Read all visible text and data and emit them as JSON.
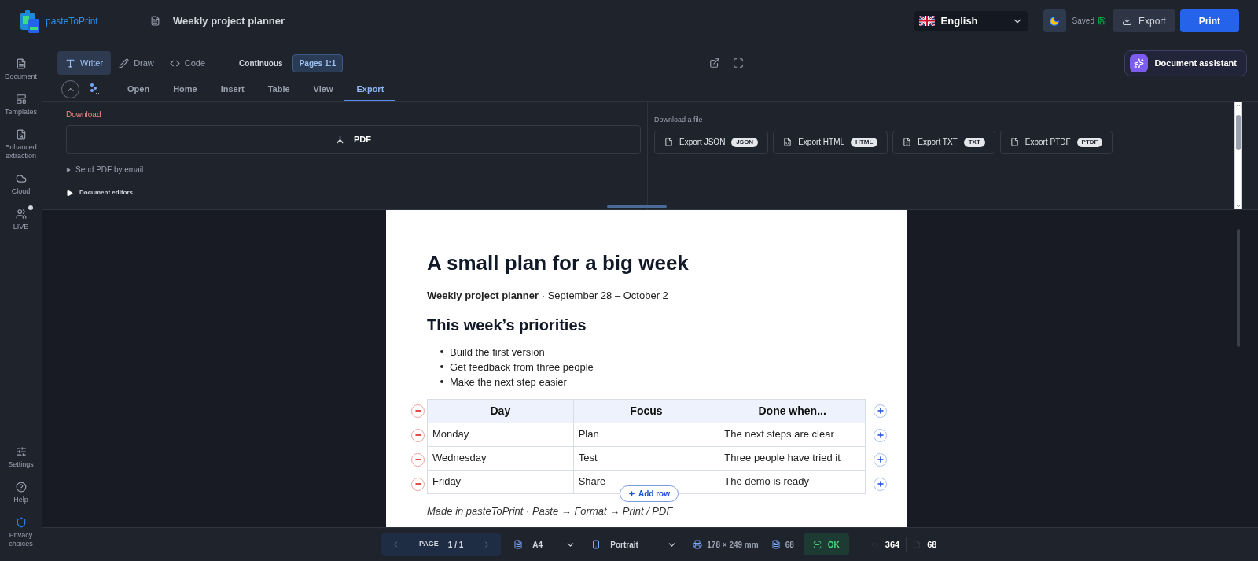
{
  "header": {
    "logo_text": "pasteToPrint",
    "doc_title": "Weekly project planner",
    "language": "English",
    "saved": "Saved",
    "export": "Export",
    "print": "Print"
  },
  "sidebar": {
    "top_items": [
      {
        "label": "Document",
        "kind": "document"
      },
      {
        "label": "Templates",
        "kind": "templates"
      },
      {
        "label": "Enhanced extraction",
        "kind": "extraction"
      },
      {
        "label": "Cloud",
        "kind": "cloud"
      },
      {
        "label": "LIVE",
        "kind": "live",
        "dot": true
      }
    ],
    "bottom_items": [
      {
        "label": "Settings",
        "kind": "settings"
      },
      {
        "label": "Help",
        "kind": "help"
      },
      {
        "label": "Privacy choices",
        "kind": "privacy"
      }
    ]
  },
  "modes": [
    {
      "label": "Writer",
      "kind": "writer",
      "selected": true
    },
    {
      "label": "Draw",
      "kind": "draw",
      "selected": false
    },
    {
      "label": "Code",
      "kind": "code",
      "selected": false
    }
  ],
  "view_modes": [
    {
      "label": "Continuous",
      "selected": false
    },
    {
      "label": "Pages 1:1",
      "selected": true
    }
  ],
  "assistant": "Document assistant",
  "ribbon_tabs": [
    {
      "label": "Open",
      "selected": false
    },
    {
      "label": "Home",
      "selected": false
    },
    {
      "label": "Insert",
      "selected": false
    },
    {
      "label": "Table",
      "selected": false
    },
    {
      "label": "View",
      "selected": false
    },
    {
      "label": "Export",
      "selected": true
    }
  ],
  "download": {
    "heading": "Download",
    "pdf": "PDF",
    "send_email": "Send PDF by email",
    "editors": "Document editors"
  },
  "files": {
    "heading": "Download a file",
    "buttons": [
      {
        "label": "Export JSON",
        "badge": "JSON",
        "kind": "file"
      },
      {
        "label": "Export HTML",
        "badge": "HTML",
        "kind": "code"
      },
      {
        "label": "Export TXT",
        "badge": "TXT",
        "kind": "text"
      },
      {
        "label": "Export PTDF",
        "badge": "PTDF",
        "kind": "file"
      }
    ]
  },
  "document": {
    "title": "A small plan for a big week",
    "subtitle": "**Weekly project planner** · September 28 – October 2",
    "heading": "This week’s priorities",
    "bullets": [
      "Build the first version",
      "Get feedback from three people",
      "Make the next step easier"
    ],
    "table": {
      "columns": [
        "Day",
        "Focus",
        "Done when..."
      ],
      "rows": [
        [
          "Monday",
          "Plan",
          "The next steps are clear"
        ],
        [
          "Wednesday",
          "Test",
          "Three people have tried it"
        ],
        [
          "Friday",
          "Share",
          "The demo is ready"
        ]
      ]
    },
    "add_row": "Add row",
    "footer_note": "Made in pasteToPrint · Paste → Format → Print / PDF"
  },
  "status_bar": {
    "page_label": "PAGE",
    "page": "1 / 1",
    "paper": "A4",
    "orientation": "Portrait",
    "size": "178 × 249 mm",
    "pages": "68",
    "status": "OK",
    "code_count": "364",
    "word_count": "68"
  }
}
